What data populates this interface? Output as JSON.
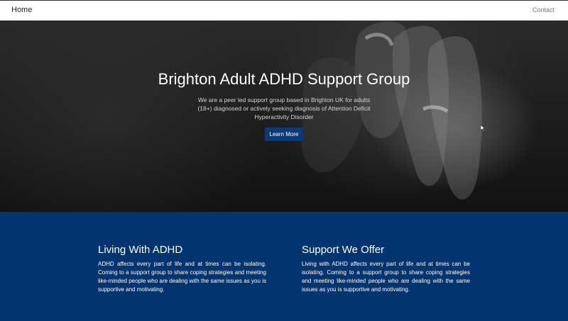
{
  "navbar": {
    "brand": "Home",
    "links": [
      {
        "label": "Contact"
      }
    ]
  },
  "hero": {
    "title": "Brighton Adult ADHD Support Group",
    "description": "We are a peer led support group based in Brighton UK for adults (18+) diagnosed or actively seeking diagnosis of Attention Deficit Hyperactivity Disorder",
    "button_label": "Learn More",
    "button_color": "#0d3a77",
    "background_image": "hands-photo"
  },
  "info": {
    "background_color": "#023470",
    "columns": [
      {
        "title": "Living With ADHD",
        "text": "ADHD affects every part of life and at times can be isolating. Coming to a support group to share coping strategies and meeting like-minded people who are dealing with the same issues as you is supportive and motivating."
      },
      {
        "title": "Support We Offer",
        "text": "Living with ADHD affects every part of life and at times can be isolating. Coming to a support group to share coping strategies and meeting like-minded people who are dealing with the same issues as you is supportive and motivating."
      }
    ]
  }
}
